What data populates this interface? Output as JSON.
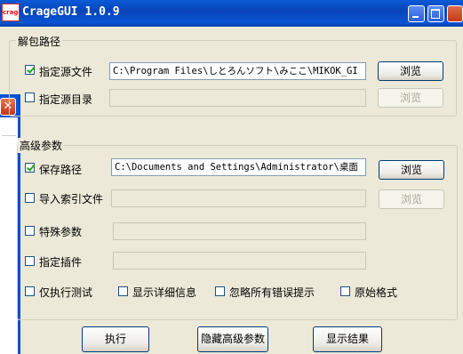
{
  "window": {
    "title": "CrageGUI 1.0.9",
    "icon_text": "crage"
  },
  "left_window": {
    "close_label": "✕"
  },
  "extract_group": {
    "legend": "解包路径",
    "source_file": {
      "label": "指定源文件",
      "checked": true,
      "value": "C:\\Program Files\\しとろんソフト\\みここ\\MIKOK_GI",
      "browse": "浏览"
    },
    "source_dir": {
      "label": "指定源目录",
      "checked": false,
      "value": "",
      "browse": "浏览"
    }
  },
  "advanced_group": {
    "legend": "高级参数",
    "save_path": {
      "label": "保存路径",
      "checked": true,
      "value": "C:\\Documents and Settings\\Administrator\\桌面",
      "browse": "浏览"
    },
    "index_file": {
      "label": "导入索引文件",
      "checked": false,
      "value": "",
      "browse": "浏览"
    },
    "special_params": {
      "label": "特殊参数",
      "checked": false,
      "value": ""
    },
    "plugin": {
      "label": "指定插件",
      "checked": false,
      "value": ""
    },
    "options": [
      {
        "label": "仅执行测试",
        "checked": false
      },
      {
        "label": "显示详细信息",
        "checked": false
      },
      {
        "label": "忽略所有错误提示",
        "checked": false
      },
      {
        "label": "原始格式",
        "checked": false
      }
    ]
  },
  "actions": {
    "execute": "执行",
    "hide_advanced": "隐藏高级参数",
    "show_results": "显示结果"
  }
}
